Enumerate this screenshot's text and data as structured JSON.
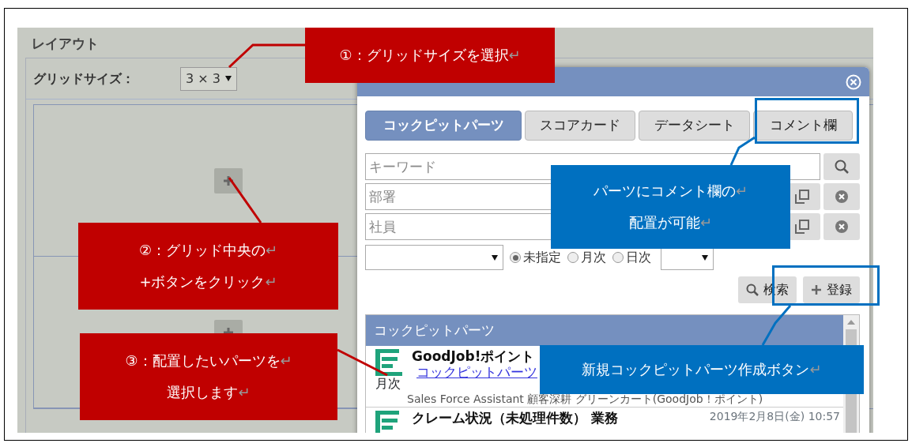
{
  "page": {
    "title": "レイアウト",
    "grid_size_label": "グリッドサイズ：",
    "grid_size": "3 × 3"
  },
  "dialog": {
    "tabs": [
      {
        "label": "コックピットパーツ",
        "selected": true
      },
      {
        "label": "スコアカード",
        "selected": false
      },
      {
        "label": "データシート",
        "selected": false
      },
      {
        "label": "コメント欄",
        "selected": false
      }
    ],
    "keyword": {
      "placeholder": "キーワード"
    },
    "department": {
      "placeholder": "部署"
    },
    "employee": {
      "placeholder": "社員"
    },
    "period_options": [
      {
        "label": "未指定",
        "selected": true
      },
      {
        "label": "月次",
        "selected": false
      },
      {
        "label": "日次",
        "selected": false
      }
    ],
    "buttons": [
      {
        "kind": "search",
        "label": "検索"
      },
      {
        "kind": "add",
        "label": "登録"
      }
    ],
    "list": {
      "header": "コックピットパーツ",
      "items": [
        {
          "icon_label": "月次",
          "title": "GoodJob!ポイント",
          "link": "コックピットパーツ",
          "description": "Sales Force Assistant 顧客深耕 グリーンカート(GoodJob！ポイント)"
        },
        {
          "title": "クレーム状況（未処理件数） 業務",
          "date": "2019年2月8日(金) 10:57"
        }
      ]
    }
  },
  "callouts": [
    {
      "color": "#c00000",
      "lines": [
        {
          "text": "①：グリッドサイズを選択",
          "mark": "↵"
        }
      ]
    },
    {
      "color": "#c00000",
      "lines": [
        {
          "text": "②：グリッド中央の",
          "mark": "↵"
        },
        {
          "text": "+ボタンをクリック",
          "mark": "↵"
        }
      ]
    },
    {
      "color": "#c00000",
      "lines": [
        {
          "text": "③：配置したいパーツを",
          "mark": "↵"
        },
        {
          "text": "選択します",
          "mark": "↵"
        }
      ]
    },
    {
      "color": "#0070c0",
      "lines": [
        {
          "text": "パーツにコメント欄の",
          "mark": "↵"
        },
        {
          "text": "配置が可能",
          "mark": "↵"
        }
      ]
    },
    {
      "color": "#0070c0",
      "lines": [
        {
          "text": "新規コックピットパーツ作成ボタン",
          "mark": "↵"
        }
      ]
    }
  ]
}
